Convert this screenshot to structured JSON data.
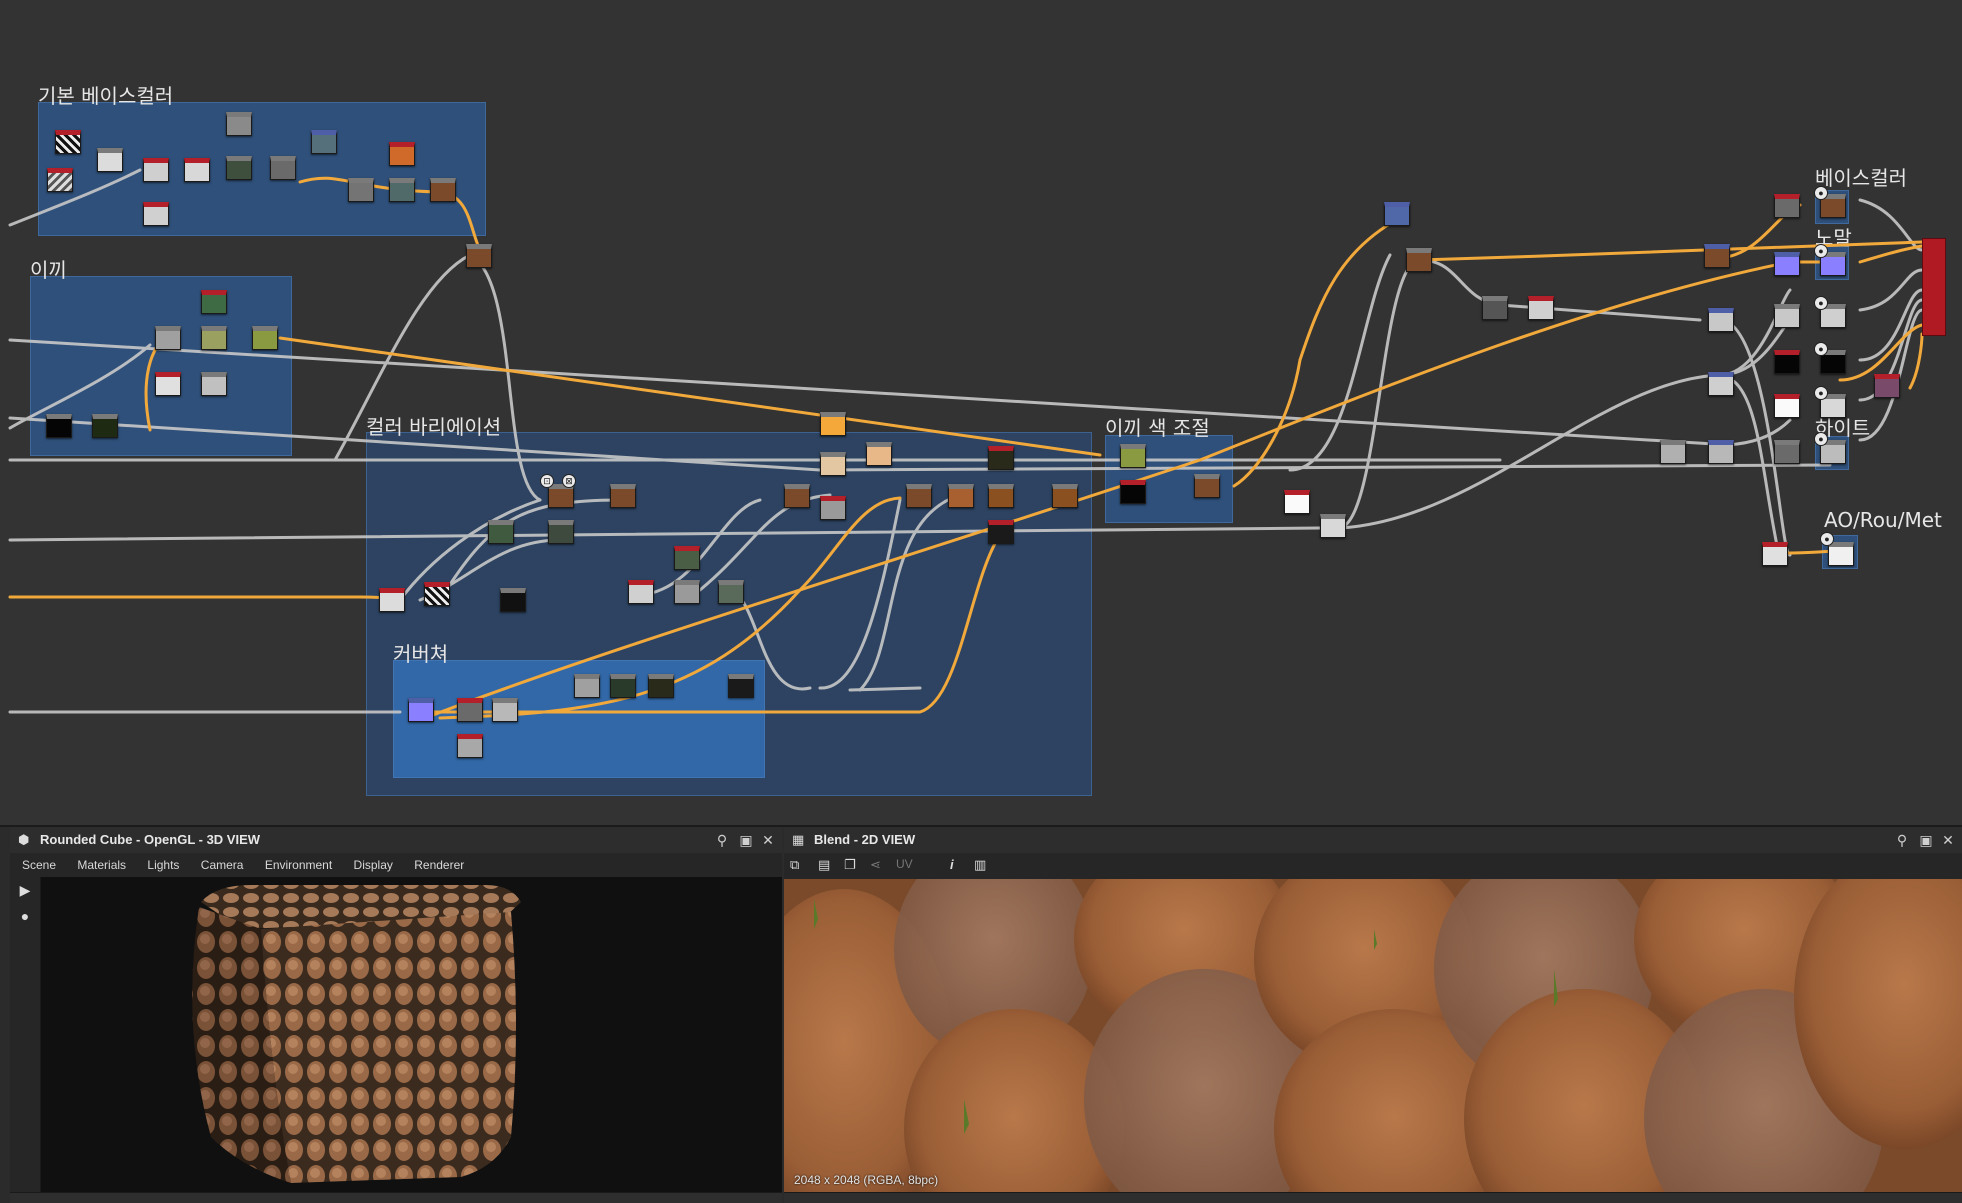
{
  "graph": {
    "frames": [
      {
        "id": "base_color",
        "title": "기본 베이스컬러"
      },
      {
        "id": "moss",
        "title": "이끼"
      },
      {
        "id": "color_variation",
        "title": "컬러 바리에이션"
      },
      {
        "id": "coverage",
        "title": "커버쳐"
      },
      {
        "id": "moss_color_adjust",
        "title": "이끼 색 조절"
      }
    ],
    "output_labels": {
      "base_color": "베이스컬러",
      "normal": "노말",
      "height": "하이트",
      "ao_rough_metal": "AO/Rou/Met"
    }
  },
  "view3d": {
    "title": "Rounded Cube - OpenGL - 3D VIEW",
    "menu": [
      "Scene",
      "Materials",
      "Lights",
      "Camera",
      "Environment",
      "Display",
      "Renderer"
    ],
    "icon": "cube-icon"
  },
  "view2d": {
    "title": "Blend - 2D VIEW",
    "uv_label": "UV",
    "image_info": "2048 x 2048 (RGBA, 8bpc)",
    "icon": "image-icon"
  },
  "colors": {
    "graph_bg": "#333333",
    "frame_blue": "#2e5c96",
    "wire_orange": "#f2a93b",
    "wire_gray": "#c8c8c8",
    "output_red": "#b01a22"
  }
}
